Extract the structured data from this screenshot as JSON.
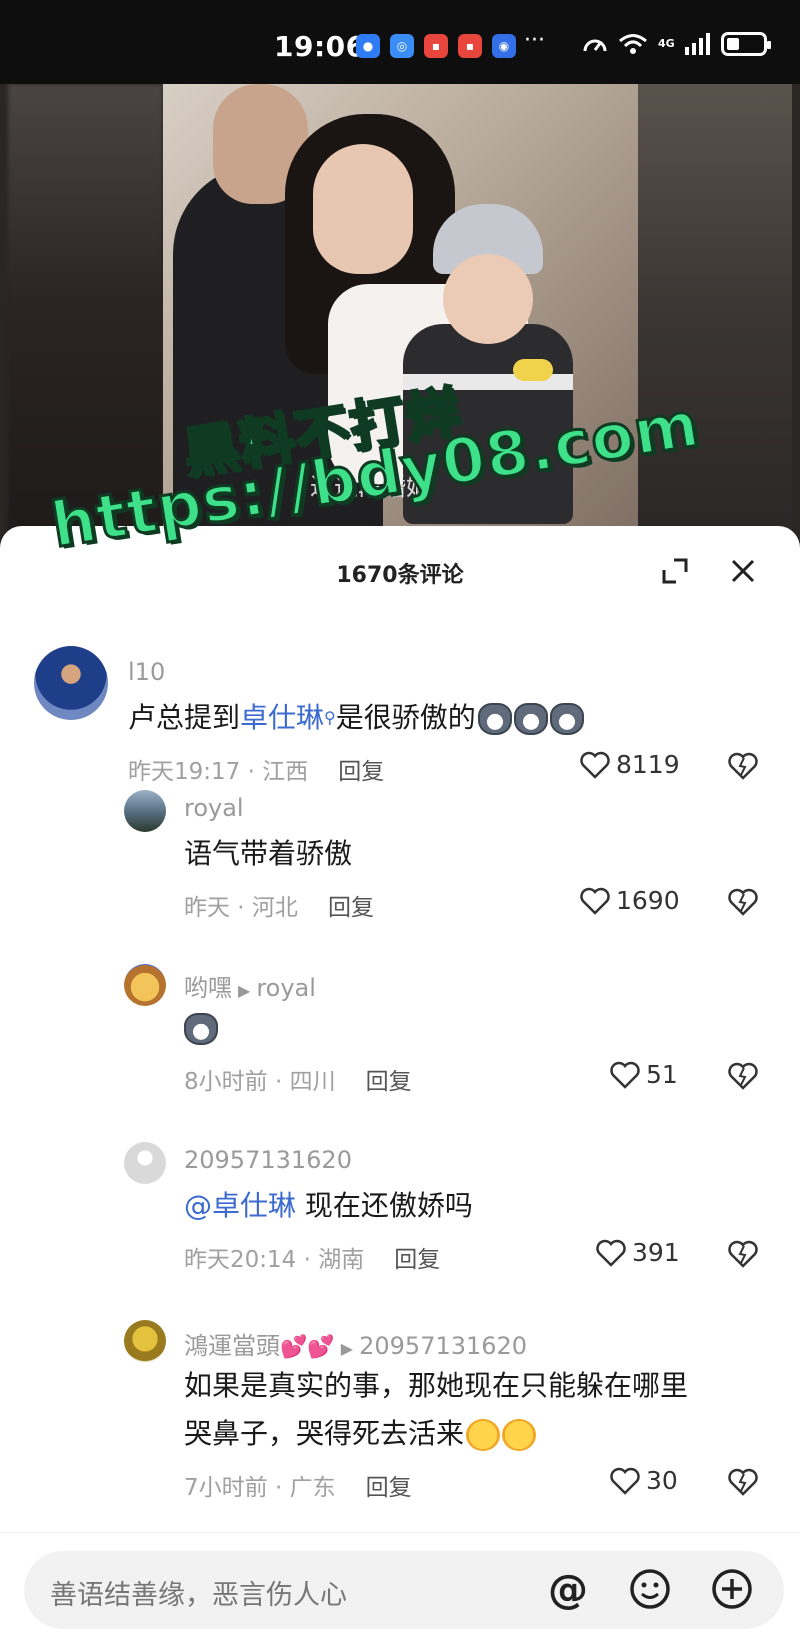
{
  "status_bar": {
    "time": "19:06",
    "network": "4G"
  },
  "video": {
    "subtitle": "过这段婚姻"
  },
  "watermark": {
    "line1": "黑料不打烊",
    "line2": "https://bdy08.com"
  },
  "sheet": {
    "title": "1670条评论"
  },
  "comments": [
    {
      "user": "l10",
      "text_before": "卢总提到",
      "mention": "卓仕琳",
      "text_after": "是很骄傲的",
      "time": "昨天19:17 · 江西",
      "reply": "回复",
      "likes": "8119"
    },
    {
      "user": "royal",
      "text": "语气带着骄傲",
      "time": "昨天 · 河北",
      "reply": "回复",
      "likes": "1690"
    },
    {
      "user": "哟嘿",
      "reply_to": "royal",
      "time": "8小时前 · 四川",
      "reply": "回复",
      "likes": "51"
    },
    {
      "user": "20957131620",
      "mention": "@卓仕琳",
      "text": " 现在还傲娇吗",
      "time": "昨天20:14 · 湖南",
      "reply": "回复",
      "likes": "391"
    },
    {
      "user": "鴻運當頭",
      "reply_to": "20957131620",
      "text_line1": "如果是真实的事，那她现在只能躲在哪里",
      "text_line2": "哭鼻子，哭得死去活来",
      "time": "7小时前 · 广东",
      "reply": "回复",
      "likes": "30"
    }
  ],
  "input": {
    "placeholder": "善语结善缘，恶言伤人心"
  }
}
